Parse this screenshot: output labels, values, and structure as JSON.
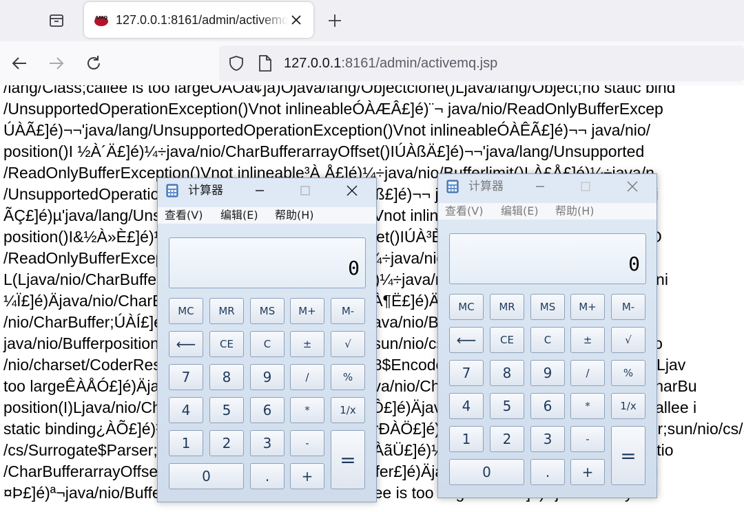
{
  "browser": {
    "tab_title": "127.0.0.1:8161/admin/activemq.jsp",
    "favicon_text": "AMQ",
    "url_host": "127.0.0.1",
    "url_rest": ":8161/admin/activemq.jsp"
  },
  "page_lines": [
    "/lang/Class;callee is too largeÓÀÓa¢]a)Ojava/lang/Objectclone()Ljava/lang/Object;no static bind",
    "/UnsupportedOperationException()Vnot inlineableÓÀÆÂ£]é)¨¬ java/nio/ReadOnlyBufferExcep",
    "ÚÀÃ£]é)¬¬'java/lang/UnsupportedOperationException()Vnot inlineableÓÀÊÃ£]é)¬¬ java/nio/",
    "position()I ½À´Ä£]é)¼÷java/nio/CharBufferarrayOffset()IÚÀßÄ£]é)¬¬'java/lang/Unsupported",
    "/ReadOnlyBufferException()Vnot inlineable³À Å£]é)¼÷java/nio/Bufferlimit()I À£Å£]é)¼÷java/n",
    "/UnsupportedOperationException()Vnot inlineableÓÀß£]é)¬¬ java/nio/ReadOnlyBufferExcepti",
    "ÃÇ£]é)µ'java/lang/UnsupportedOperationException()Vnot inlineableÓÀÄ£]é)¬¬ java/nio/Read",
    "position()I&½À»È£]é)¼÷java/nio/CharBufferarrayOffset()IÚÀ³È£]é)¬¬'java/lang/UnsupportedO",
    "/ReadOnlyBufferException()Vnot inlineable³ÀÉÉ£]é)¼÷java/nio/Bufferlimit()I À¹É£]é)¼÷java/",
    "L(Ljava/nio/CharBuffer;)Ljava/nio/CharBuffer;ÚÀÊ£]é)¼÷java/nio/Bufferposition()I £]é)¼÷sun/ni",
    "¼Ï£]é)Äjava/nio/CharBufferget()Ccallee is too largeÊÀ¶Ë£]é)Äjava/nio/CharBufferpositio",
    "/nio/CharBuffer;ÚÀÍ£]é)¼÷java/nio/Bufferposition(I)Ljava/nio/Buffer;callee is too largeÐÀ¬Ñ",
    "java/nio/Bufferposition()Ino static binding¿ÀÃÎ£]é)¼÷sun/nio/cs/UTF_8$Encoder;UTF_8$Enco",
    "/nio/charset/CoderResult;ÚÀÏ£]é)¼÷sun/nio/cs/UTF_8$Encoderupdate(Ljava/nio/CharBuffer;ILjav",
    "too largeÊÀÅÓ£]é)Äjava/nio/CharBufferposition(I)Ljava/nio/CharBuffer;ÓÀÂÔ£]é)Äjava/nio/CharBu",
    "position(I)Ljava/nio/CharBuffer;callee is too largeÆÀÔ£]é)Äjava/nio/ByteBufferarrayOffset()Icallee i",
    "static binding¿ÀÕ£]é)¼÷sun/nio/cs/Surrogate$ParserÐÀÖ£]é)¼÷sun/nio/cs/Surrogate$Parser;sun/nio/cs/Surrogate",
    "/cs/Surrogate$Parser;ÚÀÖ£]é)¼÷callee is too largeãÀãÜ£]é)¼÷sun/nio/cs/UTF_8updatePositio",
    "/CharBufferarrayOffset()IÚÀ¤Ø£]é)Äjava/nio/CharBuffer£]é)Äjava/nio/CharBuffer;Ljava/nio/Bu",
    "¤Þ£]é)ª¬java/nio/Bufferposition(I)Ljava/nio/Buffer;callee is too largeÐÀÑÞ£]é)Äjava/nio/ByteB"
  ],
  "calculators": [
    {
      "title": "计算器",
      "menu": [
        "查看(V)",
        "编辑(E)",
        "帮助(H)"
      ],
      "display": "0",
      "keys": {
        "mc": "MC",
        "mr": "MR",
        "ms": "MS",
        "mplus": "M+",
        "mminus": "M-",
        "backspace": "⟵",
        "ce": "CE",
        "c": "C",
        "plusminus": "±",
        "sqrt": "√",
        "d7": "7",
        "d8": "8",
        "d9": "9",
        "divide": "/",
        "percent": "%",
        "d4": "4",
        "d5": "5",
        "d6": "6",
        "multiply": "*",
        "reciprocal": "1/x",
        "d1": "1",
        "d2": "2",
        "d3": "3",
        "minus": "-",
        "equals": "=",
        "d0": "0",
        "dot": ".",
        "plus": "+"
      }
    },
    {
      "title": "计算器",
      "menu": [
        "查看(V)",
        "编辑(E)",
        "帮助(H)"
      ],
      "display": "0",
      "keys": {
        "mc": "MC",
        "mr": "MR",
        "ms": "MS",
        "mplus": "M+",
        "mminus": "M-",
        "backspace": "⟵",
        "ce": "CE",
        "c": "C",
        "plusminus": "±",
        "sqrt": "√",
        "d7": "7",
        "d8": "8",
        "d9": "9",
        "divide": "/",
        "percent": "%",
        "d4": "4",
        "d5": "5",
        "d6": "6",
        "multiply": "*",
        "reciprocal": "1/x",
        "d1": "1",
        "d2": "2",
        "d3": "3",
        "minus": "-",
        "equals": "=",
        "d0": "0",
        "dot": ".",
        "plus": "+"
      }
    }
  ]
}
